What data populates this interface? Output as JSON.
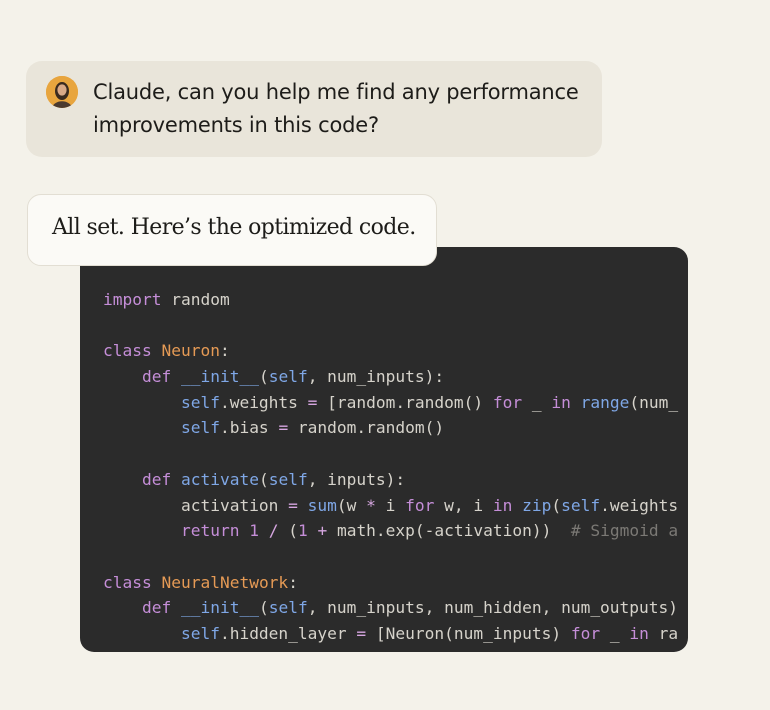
{
  "user_message": {
    "text": "Claude, can you help me find any performance improvements in this code?",
    "avatar_icon": "user-avatar-icon"
  },
  "assistant_message": {
    "text": "All set. Here’s the optimized code."
  },
  "code": {
    "lines": [
      "import random",
      "",
      "class Neuron:",
      "    def __init__(self, num_inputs):",
      "        self.weights = [random.random() for _ in range(num_",
      "        self.bias = random.random()",
      "",
      "    def activate(self, inputs):",
      "        activation = sum(w * i for w, i in zip(self.weights",
      "        return 1 / (1 + math.exp(-activation))  # Sigmoid a",
      "",
      "class NeuralNetwork:",
      "    def __init__(self, num_inputs, num_hidden, num_outputs)",
      "        self.hidden_layer = [Neuron(num_inputs) for _ in ra"
    ]
  },
  "colors": {
    "background": "#f4f2ea",
    "user_bubble": "#e9e5da",
    "code_background": "#2b2b2b",
    "keyword": "#c58ed8",
    "function": "#7fa7e6",
    "class_name": "#e59a55",
    "comment": "#7b7975"
  }
}
